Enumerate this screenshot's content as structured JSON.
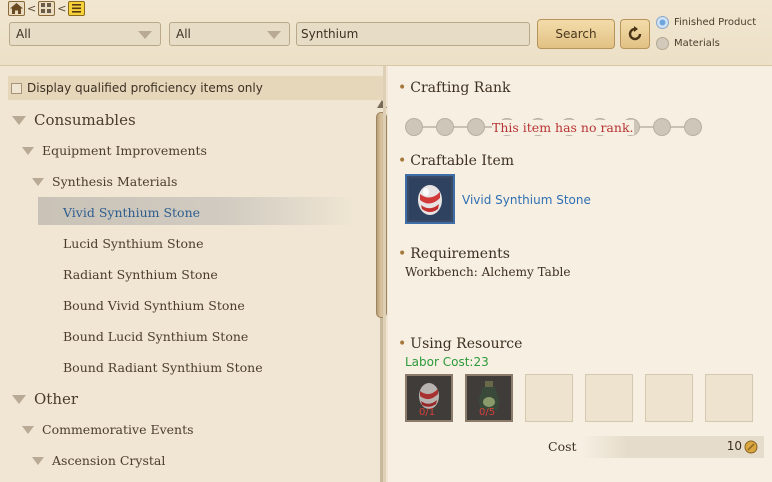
{
  "toolbar": {
    "breadcrumb_sep": "<",
    "filter1": "All",
    "filter2": "All",
    "search_value": "Synthium",
    "search_label": "Search",
    "radio_finished": "Finished Product",
    "radio_materials": "Materials",
    "selected_radio": "Finished Product"
  },
  "left": {
    "qualified_label": "Display qualified proficiency items only",
    "tree": [
      {
        "label": "Consumables",
        "level": 0,
        "expanded": true
      },
      {
        "label": "Equipment Improvements",
        "level": 1,
        "expanded": true
      },
      {
        "label": "Synthesis Materials",
        "level": 2,
        "expanded": true
      },
      {
        "label": "Vivid Synthium Stone",
        "level": 3,
        "selected": true
      },
      {
        "label": "Lucid Synthium Stone",
        "level": 3
      },
      {
        "label": "Radiant Synthium Stone",
        "level": 3
      },
      {
        "label": "Bound Vivid Synthium Stone",
        "level": 3
      },
      {
        "label": "Bound Lucid Synthium Stone",
        "level": 3
      },
      {
        "label": "Bound Radiant Synthium Stone",
        "level": 3
      },
      {
        "label": "Other",
        "level": 0,
        "expanded": true
      },
      {
        "label": "Commemorative Events",
        "level": 1,
        "expanded": true
      },
      {
        "label": "Ascension Crystal",
        "level": 2,
        "expanded": true
      }
    ]
  },
  "right": {
    "crafting_rank_title": "Crafting Rank",
    "rank_message": "This item has no rank.",
    "craftable_title": "Craftable Item",
    "craftable_item_name": "Vivid Synthium Stone",
    "requirements_title": "Requirements",
    "requirements_text": "Workbench: Alchemy Table",
    "using_resource_title": "Using Resource",
    "labor_cost": "Labor Cost:23",
    "resources": [
      {
        "count": "0/1",
        "icon": "red-stone-icon"
      },
      {
        "count": "0/5",
        "icon": "potion-bottle-icon"
      }
    ],
    "cost_label": "Cost",
    "cost_value": "10"
  },
  "colors": {
    "link_blue": "#2f6fb3",
    "labor_green": "#2d9a3a",
    "warning_red": "#b83434",
    "selected_blue": "#2e5e8e"
  }
}
